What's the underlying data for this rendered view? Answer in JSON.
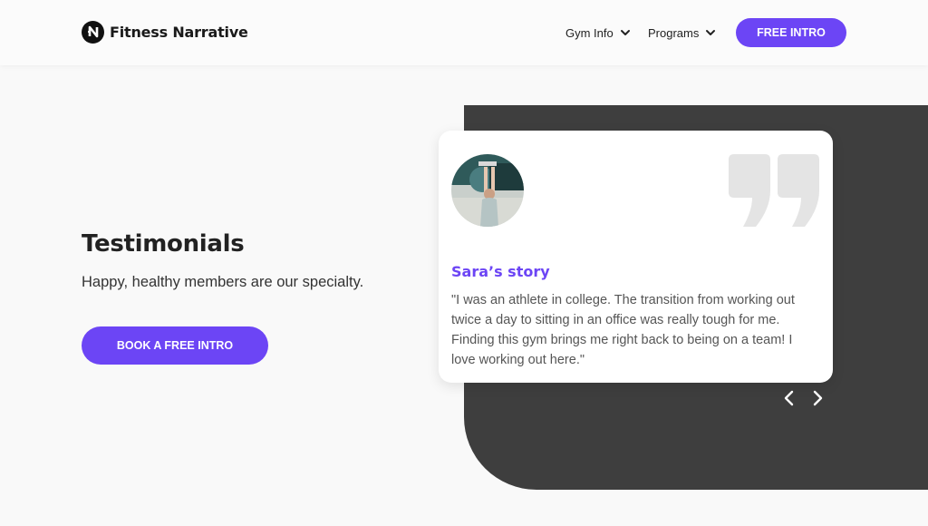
{
  "header": {
    "brand": "Fitness Narrative",
    "nav": {
      "gym_info": "Gym Info",
      "programs": "Programs"
    },
    "cta": "FREE INTRO"
  },
  "hero": {
    "heading": "Testimonials",
    "subheading": "Happy, healthy members are our specialty.",
    "cta": "BOOK A FREE INTRO"
  },
  "testimonial": {
    "title": "Sara’s story",
    "quote": "\"I was an athlete in college. The transition from working out twice a day to sitting in an office was really tough for me. Finding this gym brings me right back to being on a team! I love working out here.\"",
    "avatar_icon": "member-photo",
    "quote_icon": "quote-marks-icon"
  },
  "carousel": {
    "prev_icon": "chevron-left-icon",
    "next_icon": "chevron-right-icon"
  },
  "colors": {
    "accent": "#6c45f5",
    "dark_panel": "#3e3e3e",
    "background": "#f9f9f9",
    "card": "#ffffff",
    "quote_mark": "#e4e4e4"
  }
}
